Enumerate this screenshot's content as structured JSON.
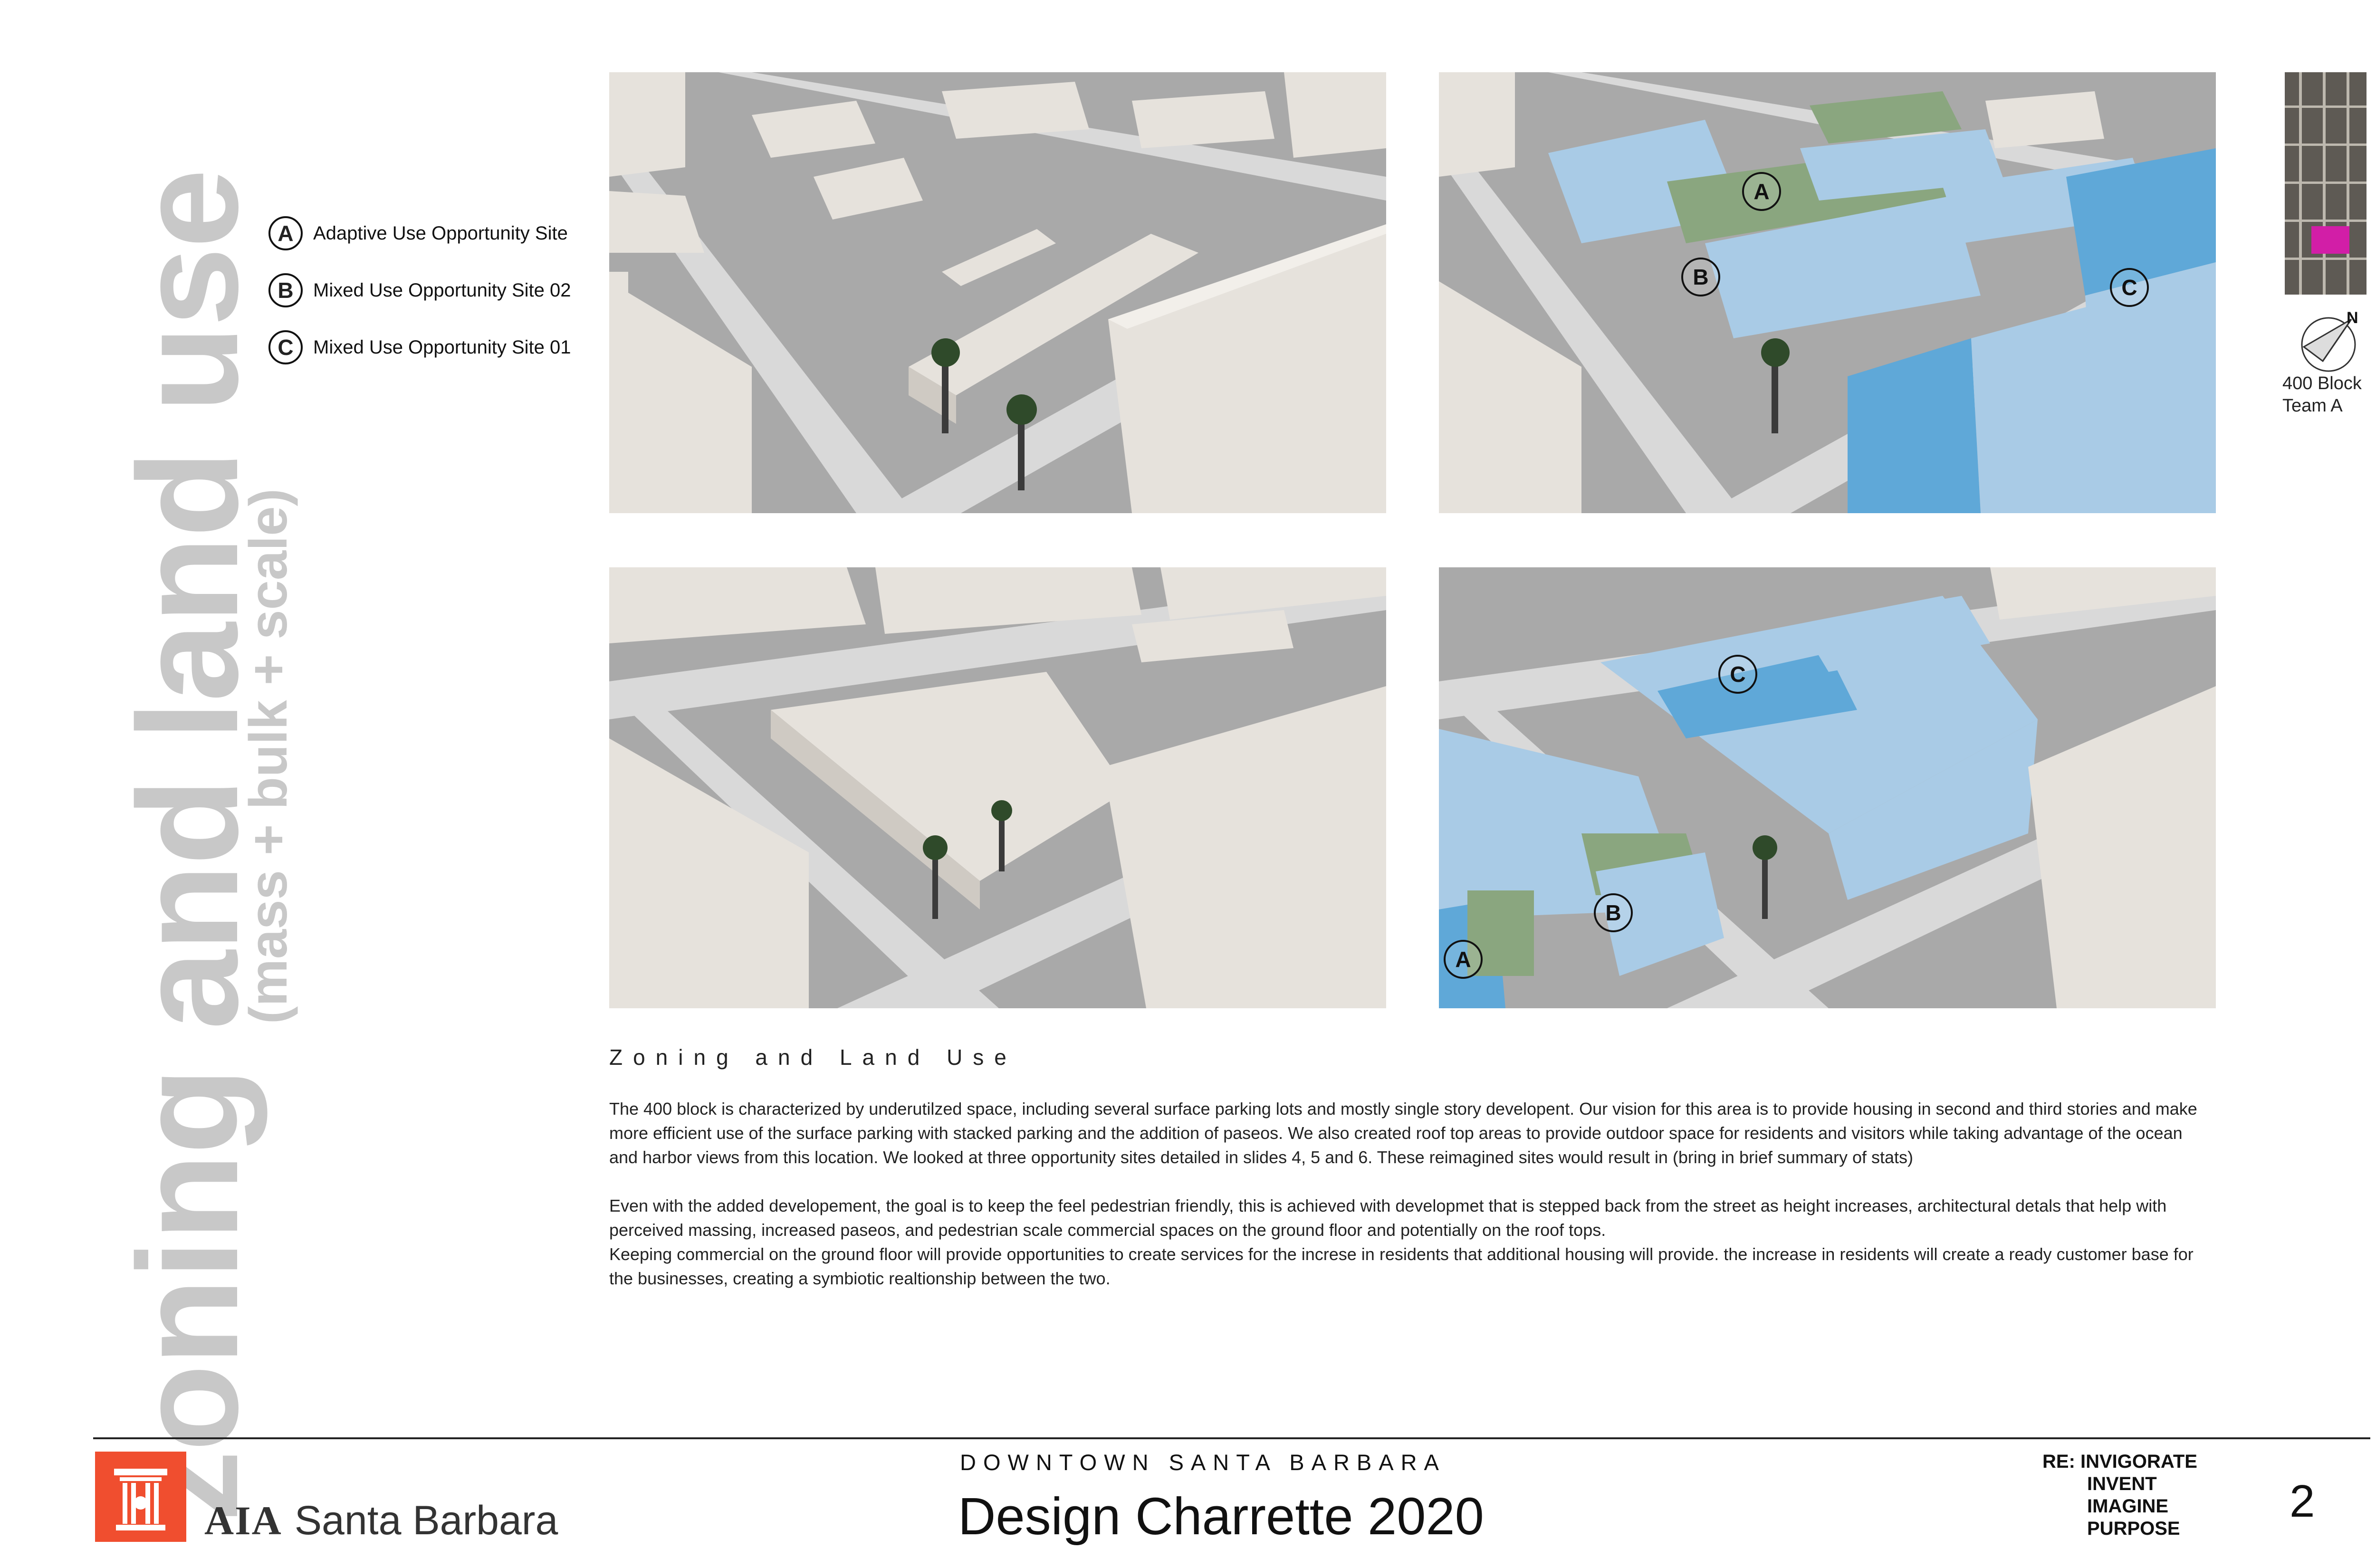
{
  "side_title": {
    "main": "zoning and land use",
    "sub": "(mass + bulk + scale)"
  },
  "legend": [
    {
      "badge": "A",
      "label": "Adaptive Use Opportunity Site"
    },
    {
      "badge": "B",
      "label": "Mixed Use Opportunity Site 02"
    },
    {
      "badge": "C",
      "label": "Mixed Use Opportunity Site 01"
    }
  ],
  "panels": {
    "top_left": {
      "markers": []
    },
    "top_right": {
      "markers": [
        "A",
        "B",
        "C"
      ]
    },
    "bottom_left": {
      "markers": []
    },
    "bottom_right": {
      "markers": [
        "C",
        "B",
        "A"
      ]
    }
  },
  "context": {
    "north_label": "N",
    "caption_line1": "400 Block",
    "caption_line2": "Team A"
  },
  "section": {
    "heading": "Zoning and Land Use",
    "paragraph1": "The 400 block is characterized by underutilzed space, including several surface parking lots and mostly single story developent. Our vision for this area is to provide housing in second and third stories and make more efficient use of the surface parking with stacked parking and the addition of paseos. We also created roof top areas to provide outdoor space for residents and visitors while taking advantage of the ocean and harbor views from this location. We looked at three opportunity sites detailed in slides 4, 5 and 6. These reimagined sites would result in (bring in brief summary of stats)",
    "paragraph2": "Even with the added developement, the goal is to keep the feel pedestrian friendly, this is achieved with developmet that is stepped back from the street as height increases, architectural detals that help with perceived massing, increased paseos, and pedestrian scale commercial spaces on the ground floor and potentially on the roof tops.",
    "paragraph3": "Keeping commercial on the ground floor will provide opportunities to create services for the increse in residents that additional housing will provide. the increase in residents will create a ready customer base for the businesses, creating a symbiotic realtionship between the two."
  },
  "footer": {
    "org_strong": "AIA",
    "org_city": "Santa Barbara",
    "eyebrow": "DOWNTOWN SANTA BARBARA",
    "title": "Design Charrette 2020",
    "re_lines": [
      "RE: INVIGORATE",
      "INVENT",
      "IMAGINE",
      "PURPOSE"
    ],
    "page_number": "2"
  },
  "colors": {
    "side_title": "#c8c8c8",
    "brand_red": "#f04e2f",
    "proposed_massing": "#a9cbe6",
    "proposed_massing_dark": "#5fa8d8",
    "rooftop_green": "#8aa67f",
    "existing_building": "#e6e2dc",
    "street": "#d9d9d9",
    "lot": "#a9a9a9"
  }
}
